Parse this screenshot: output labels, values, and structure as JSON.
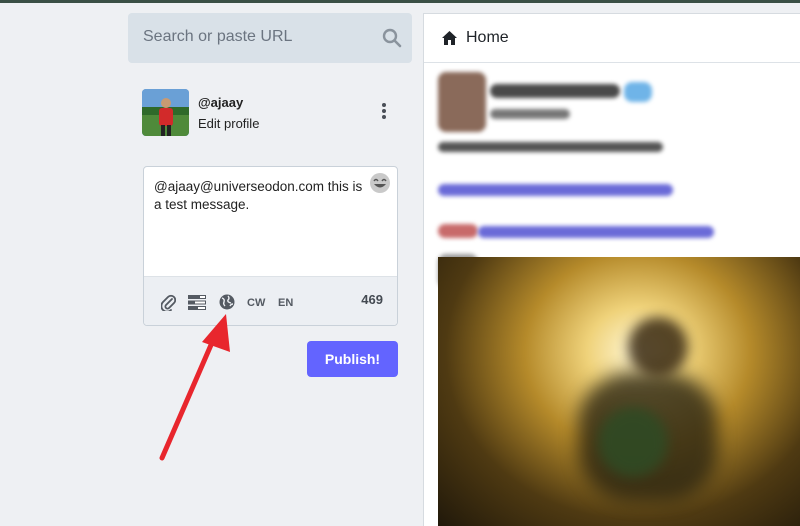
{
  "search": {
    "placeholder": "Search or paste URL"
  },
  "account": {
    "handle": "@ajaay",
    "edit_label": "Edit profile"
  },
  "composer": {
    "text": "@ajaay@universeodon.com this is a test message.",
    "cw_label": "CW",
    "language_label": "EN",
    "char_count": "469",
    "icons": [
      "paperclip-icon",
      "poll-icon",
      "globe-icon",
      "emoji-icon"
    ]
  },
  "publish_label": "Publish!",
  "column": {
    "title": "Home",
    "icon": "home-icon"
  },
  "colors": {
    "accent": "#6364ff",
    "arrow": "#e8262d"
  }
}
